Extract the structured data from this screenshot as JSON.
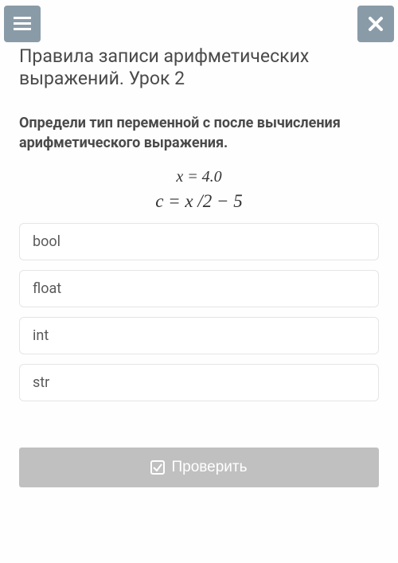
{
  "header": {
    "menu_icon": "menu",
    "close_icon": "close"
  },
  "title": "Правила записи арифметических выражений. Урок 2",
  "question": "Определи тип переменной c после вычисления арифметического выражения.",
  "expression": {
    "line1": "x = 4.0",
    "line2": "c = x /2 − 5"
  },
  "options": [
    "bool",
    "float",
    "int",
    "str"
  ],
  "check_button": "Проверить"
}
